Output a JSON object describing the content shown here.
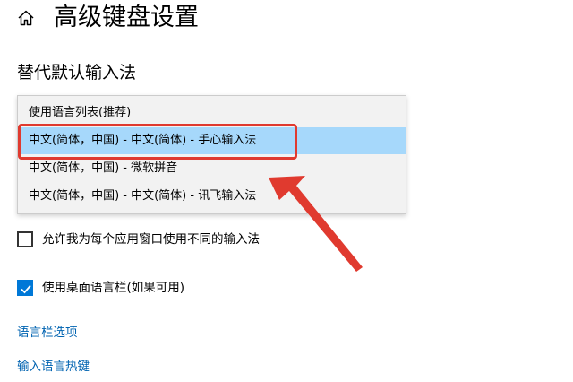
{
  "header": {
    "title": "高级键盘设置",
    "home_icon": "home-icon"
  },
  "section": {
    "heading": "替代默认输入法"
  },
  "dropdown": {
    "options": [
      {
        "label": "使用语言列表(推荐)",
        "selected": false
      },
      {
        "label": "中文(简体，中国) - 中文(简体) - 手心输入法",
        "selected": true
      },
      {
        "label": "中文(简体，中国) - 微软拼音",
        "selected": false
      },
      {
        "label": "中文(简体，中国) - 中文(简体) - 讯飞输入法",
        "selected": false
      }
    ],
    "selected_color": "#a6d8fb"
  },
  "annotation": {
    "color": "#e03a2f"
  },
  "checkboxes": [
    {
      "label": "允许我为每个应用窗口使用不同的输入法",
      "checked": false
    },
    {
      "label": "使用桌面语言栏(如果可用)",
      "checked": true
    }
  ],
  "links": [
    {
      "label": "语言栏选项"
    },
    {
      "label": "输入语言热键"
    }
  ],
  "accent_color": "#0078d7"
}
